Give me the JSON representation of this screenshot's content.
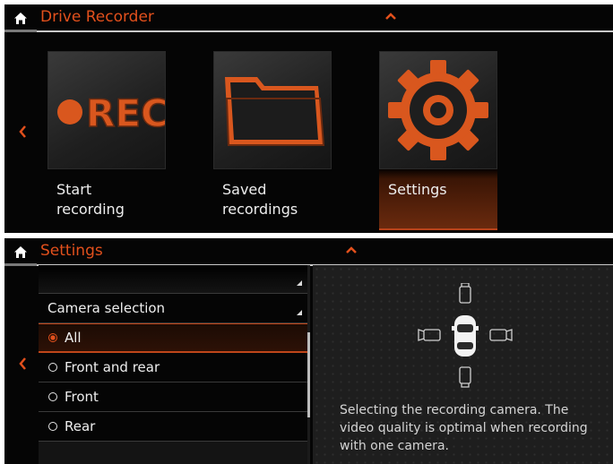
{
  "drive_recorder_screen": {
    "title": "Drive Recorder",
    "tiles": [
      {
        "label": "Start\nrecording",
        "icon": "rec-icon",
        "icon_text": "REC",
        "selected": false
      },
      {
        "label": "Saved\nrecordings",
        "icon": "folder-icon",
        "selected": false
      },
      {
        "label": "Settings",
        "icon": "gear-icon",
        "selected": true
      }
    ]
  },
  "settings_screen": {
    "title": "Settings",
    "list": {
      "section_header": "Camera selection",
      "options": [
        {
          "label": "All",
          "selected": true
        },
        {
          "label": "Front and rear",
          "selected": false
        },
        {
          "label": "Front",
          "selected": false
        },
        {
          "label": "Rear",
          "selected": false
        }
      ]
    },
    "info_text": "Selecting the recording camera. The video quality is optimal when recording with one camera."
  },
  "colors": {
    "accent": "#e2501c",
    "background": "#050505",
    "text": "#eeeeee"
  }
}
